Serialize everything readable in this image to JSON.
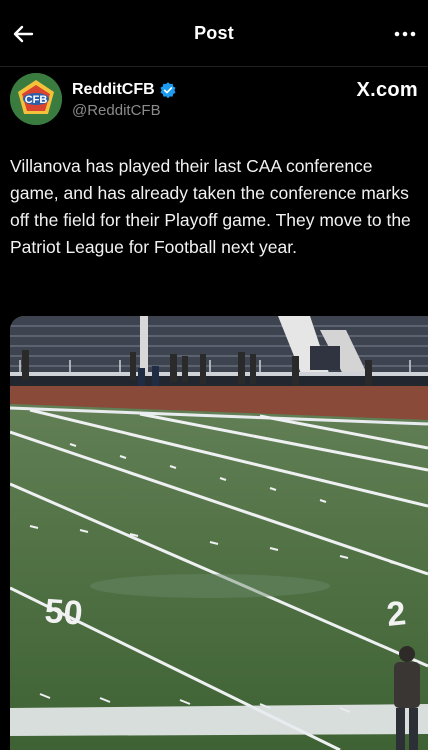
{
  "header": {
    "title": "Post",
    "back_icon": "arrow-left-icon",
    "more_icon": "more-horizontal-icon"
  },
  "author": {
    "display_name": "RedditCFB",
    "handle": "@RedditCFB",
    "verified": true,
    "avatar_text": "CFB",
    "verified_color": "#1d9bf0"
  },
  "source": {
    "label": "X.com"
  },
  "post": {
    "text": "Villanova has played their last CAA conference game, and has already taken the conference marks off the field for their Playoff game. They move to the Patriot League for Football next year."
  },
  "media": {
    "description_icon": "football-field-photo",
    "yard_number_left": "50",
    "yard_number_right": "2"
  }
}
